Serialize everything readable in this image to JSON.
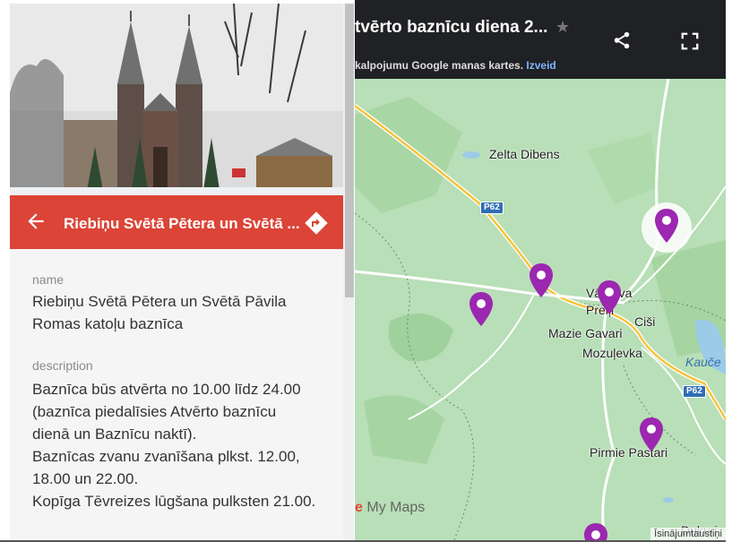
{
  "header": {
    "map_title": "tvērto baznīcu diena 2...",
    "subtitle_text": "kalpojumu Google manas kartes.",
    "subtitle_link": "Izveid"
  },
  "panel": {
    "title": "Riebiņu Svētā Pētera un Svētā ...",
    "name_label": "name",
    "name_value": "Riebiņu Svētā Pētera un Svētā Pāvila Romas katoļu baznīca",
    "description_label": "description",
    "description_lines": [
      "Baznīca būs atvērta no 10.00 līdz 24.00",
      "(baznīca piedalīsies Atvērto baznīcu",
      "dienā un Baznīcu naktī).",
      "Baznīcas zvanu zvanīšana plkst. 12.00,",
      "18.00 un 22.00.",
      "Kopīga Tēvreizes lūgšana pulksten 21.00."
    ]
  },
  "map": {
    "places": [
      "Zelta Dibens",
      "Vārkava",
      "Preiļi",
      "Ciši",
      "Mazie Gavari",
      "Mozuļevka",
      "Pirmie Pastari",
      "Dukuri"
    ],
    "water_label": "Kauče",
    "road_shields": [
      "P62",
      "P62"
    ],
    "branding": "My Maps",
    "shortcuts": "Īsinājumtaustiņi"
  },
  "colors": {
    "panel_accent": "#db4437",
    "header_bg": "#202124",
    "map_bg": "#b8dfb7",
    "pin": "#9c27b0"
  },
  "icons": [
    "arrow-back-icon",
    "directions-icon",
    "star-icon",
    "share-icon",
    "fullscreen-icon",
    "map-pin-icon"
  ]
}
